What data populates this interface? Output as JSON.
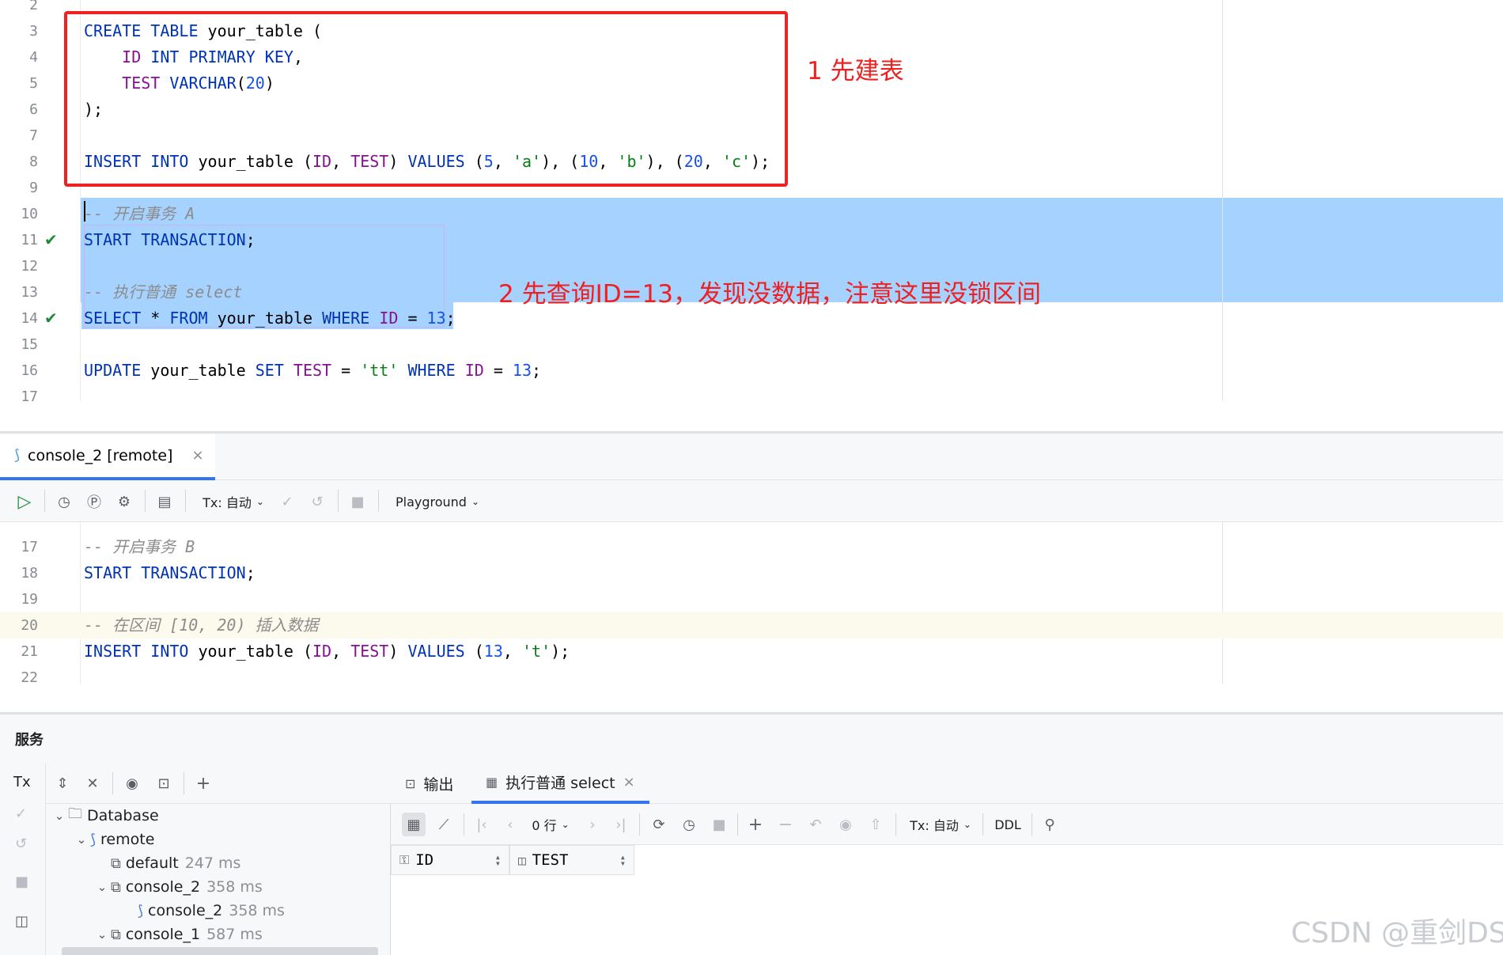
{
  "top_editor": {
    "lines": [
      {
        "n": "2",
        "tokens": []
      },
      {
        "n": "3",
        "tokens": [
          {
            "t": "kw",
            "v": "CREATE TABLE "
          },
          {
            "t": "",
            "v": "your_table ("
          }
        ]
      },
      {
        "n": "4",
        "tokens": [
          {
            "t": "",
            "v": "    "
          },
          {
            "t": "fd",
            "v": "ID"
          },
          {
            "t": "",
            "v": " "
          },
          {
            "t": "kw",
            "v": "INT PRIMARY KEY"
          },
          {
            "t": "",
            "v": ","
          }
        ]
      },
      {
        "n": "5",
        "tokens": [
          {
            "t": "",
            "v": "    "
          },
          {
            "t": "fd",
            "v": "TEST"
          },
          {
            "t": "",
            "v": " "
          },
          {
            "t": "kw",
            "v": "VARCHAR"
          },
          {
            "t": "",
            "v": "("
          },
          {
            "t": "num",
            "v": "20"
          },
          {
            "t": "",
            "v": ")"
          }
        ]
      },
      {
        "n": "6",
        "tokens": [
          {
            "t": "",
            "v": ");"
          }
        ]
      },
      {
        "n": "7",
        "tokens": []
      },
      {
        "n": "8",
        "tokens": [
          {
            "t": "kw",
            "v": "INSERT INTO "
          },
          {
            "t": "",
            "v": "your_table ("
          },
          {
            "t": "fd",
            "v": "ID"
          },
          {
            "t": "",
            "v": ", "
          },
          {
            "t": "fd",
            "v": "TEST"
          },
          {
            "t": "",
            "v": ") "
          },
          {
            "t": "kw",
            "v": "VALUES "
          },
          {
            "t": "",
            "v": "("
          },
          {
            "t": "num",
            "v": "5"
          },
          {
            "t": "",
            "v": ", "
          },
          {
            "t": "str",
            "v": "'a'"
          },
          {
            "t": "",
            "v": "), ("
          },
          {
            "t": "num",
            "v": "10"
          },
          {
            "t": "",
            "v": ", "
          },
          {
            "t": "str",
            "v": "'b'"
          },
          {
            "t": "",
            "v": "), ("
          },
          {
            "t": "num",
            "v": "20"
          },
          {
            "t": "",
            "v": ", "
          },
          {
            "t": "str",
            "v": "'c'"
          },
          {
            "t": "",
            "v": ");"
          }
        ]
      },
      {
        "n": "9",
        "tokens": []
      },
      {
        "n": "10",
        "tokens": [
          {
            "t": "cm",
            "v": "-- 开启事务 A"
          }
        ]
      },
      {
        "n": "11",
        "check": true,
        "tokens": [
          {
            "t": "kw",
            "v": "START TRANSACTION"
          },
          {
            "t": "",
            "v": ";"
          }
        ]
      },
      {
        "n": "12",
        "tokens": []
      },
      {
        "n": "13",
        "tokens": [
          {
            "t": "cm",
            "v": "-- 执行普通 select"
          }
        ]
      },
      {
        "n": "14",
        "check": true,
        "tokens": [
          {
            "t": "kw",
            "v": "SELECT "
          },
          {
            "t": "",
            "v": "* "
          },
          {
            "t": "kw",
            "v": "FROM "
          },
          {
            "t": "",
            "v": "your_table "
          },
          {
            "t": "kw",
            "v": "WHERE "
          },
          {
            "t": "fd",
            "v": "ID"
          },
          {
            "t": "",
            "v": " = "
          },
          {
            "t": "num",
            "v": "13"
          },
          {
            "t": "",
            "v": ";"
          }
        ]
      },
      {
        "n": "15",
        "tokens": []
      },
      {
        "n": "16",
        "tokens": [
          {
            "t": "kw",
            "v": "UPDATE "
          },
          {
            "t": "",
            "v": "your_table "
          },
          {
            "t": "kw",
            "v": "SET "
          },
          {
            "t": "fd",
            "v": "TEST"
          },
          {
            "t": "",
            "v": " = "
          },
          {
            "t": "str",
            "v": "'tt'"
          },
          {
            "t": "",
            "v": " "
          },
          {
            "t": "kw",
            "v": "WHERE "
          },
          {
            "t": "fd",
            "v": "ID"
          },
          {
            "t": "",
            "v": " = "
          },
          {
            "t": "num",
            "v": "13"
          },
          {
            "t": "",
            "v": ";"
          }
        ]
      },
      {
        "n": "17",
        "tokens": []
      }
    ]
  },
  "annotations": {
    "a1": "1 先建表",
    "a2": "2 先查询ID=13，发现没数据，注意这里没锁区间"
  },
  "tab": {
    "label": "console_2 [remote]",
    "close": "×"
  },
  "toolbar": {
    "tx": "Tx: 自动",
    "playground": "Playground"
  },
  "bottom_editor": {
    "lines": [
      {
        "n": "17",
        "tokens": [
          {
            "t": "cm",
            "v": "-- 开启事务 B"
          }
        ]
      },
      {
        "n": "18",
        "tokens": [
          {
            "t": "kw",
            "v": "START TRANSACTION"
          },
          {
            "t": "",
            "v": ";"
          }
        ]
      },
      {
        "n": "19",
        "tokens": []
      },
      {
        "n": "20",
        "current": true,
        "tokens": [
          {
            "t": "cm",
            "v": "-- 在区间 [10, 20) 插入数据"
          }
        ]
      },
      {
        "n": "21",
        "tokens": [
          {
            "t": "kw",
            "v": "INSERT INTO "
          },
          {
            "t": "",
            "v": "your_table ("
          },
          {
            "t": "fd",
            "v": "ID"
          },
          {
            "t": "",
            "v": ", "
          },
          {
            "t": "fd",
            "v": "TEST"
          },
          {
            "t": "",
            "v": ") "
          },
          {
            "t": "kw",
            "v": "VALUES "
          },
          {
            "t": "",
            "v": "("
          },
          {
            "t": "num",
            "v": "13"
          },
          {
            "t": "",
            "v": ", "
          },
          {
            "t": "str",
            "v": "'t'"
          },
          {
            "t": "",
            "v": ");"
          }
        ]
      },
      {
        "n": "22",
        "tokens": []
      }
    ]
  },
  "services": {
    "title": "服务",
    "tx_label": "Tx",
    "tree": {
      "database": "Database",
      "remote": "remote",
      "default": {
        "name": "default",
        "ms": "247 ms"
      },
      "console_2": {
        "name": "console_2",
        "ms": "358 ms"
      },
      "console_2_child": {
        "name": "console_2",
        "ms": "358 ms"
      },
      "console_1": {
        "name": "console_1",
        "ms": "587 ms"
      }
    },
    "tabs": {
      "output": "输出",
      "result": "执行普通 select",
      "close": "×"
    },
    "result_toolbar": {
      "rows": "0 行",
      "tx": "Tx: 自动",
      "ddl": "DDL"
    },
    "columns": [
      "ID",
      "TEST"
    ]
  },
  "watermark": "CSDN @重剑DS",
  "colors": {
    "accent": "#3574f0",
    "selection": "#a6d2ff",
    "annotation": "#ee2020",
    "keyword": "#0033b3"
  }
}
